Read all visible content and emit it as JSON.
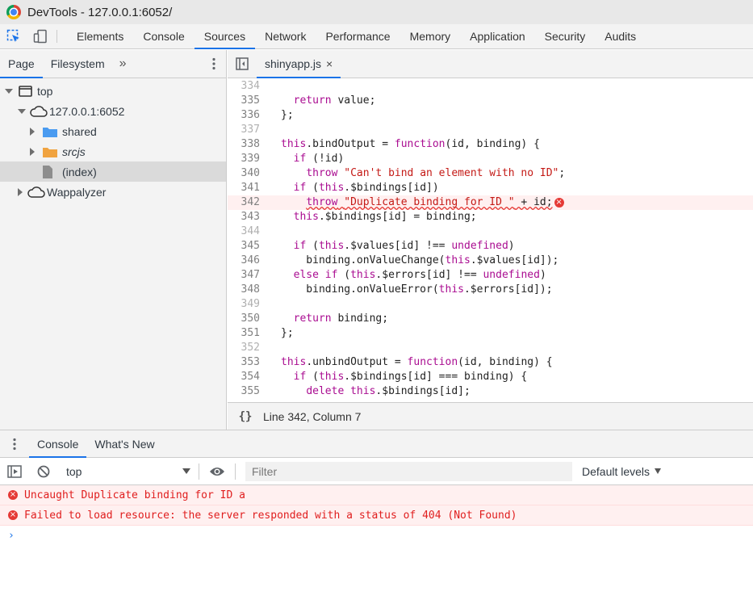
{
  "window": {
    "title": "DevTools - 127.0.0.1:6052/"
  },
  "main_tabs": [
    "Elements",
    "Console",
    "Sources",
    "Network",
    "Performance",
    "Memory",
    "Application",
    "Security",
    "Audits"
  ],
  "main_tabs_active": "Sources",
  "navigator": {
    "tabs": [
      "Page",
      "Filesystem"
    ],
    "active_tab": "Page",
    "more_symbol": "»",
    "tree": [
      {
        "label": "top",
        "expanded": true,
        "icon": "frame-icon",
        "selected": false
      },
      {
        "label": "127.0.0.1:6052",
        "expanded": true,
        "icon": "cloud-icon",
        "selected": false
      },
      {
        "label": "shared",
        "expanded": false,
        "icon": "folder-icon",
        "selected": false
      },
      {
        "label": "srcjs",
        "expanded": false,
        "icon": "folder-icon",
        "selected": false
      },
      {
        "label": "(index)",
        "expanded": null,
        "icon": "file-icon",
        "selected": true
      },
      {
        "label": "Wappalyzer",
        "expanded": false,
        "icon": "cloud-icon",
        "selected": false
      }
    ]
  },
  "editor": {
    "file_tab": "shinyapp.js",
    "close_symbol": "×",
    "lines": [
      {
        "n": "334",
        "code": "",
        "error": false
      },
      {
        "n": "335",
        "code": "    return value;",
        "error": false
      },
      {
        "n": "336",
        "code": "  };",
        "error": false
      },
      {
        "n": "337",
        "code": "",
        "error": false
      },
      {
        "n": "338",
        "code": "  this.bindOutput = function(id, binding) {",
        "error": false
      },
      {
        "n": "339",
        "code": "    if (!id)",
        "error": false
      },
      {
        "n": "340",
        "code": "      throw \"Can't bind an element with no ID\";",
        "error": false
      },
      {
        "n": "341",
        "code": "    if (this.$bindings[id])",
        "error": false
      },
      {
        "n": "342",
        "code": "      throw \"Duplicate binding for ID \" + id;",
        "error": true
      },
      {
        "n": "343",
        "code": "    this.$bindings[id] = binding;",
        "error": false
      },
      {
        "n": "344",
        "code": "",
        "error": false
      },
      {
        "n": "345",
        "code": "    if (this.$values[id] !== undefined)",
        "error": false
      },
      {
        "n": "346",
        "code": "      binding.onValueChange(this.$values[id]);",
        "error": false
      },
      {
        "n": "347",
        "code": "    else if (this.$errors[id] !== undefined)",
        "error": false
      },
      {
        "n": "348",
        "code": "      binding.onValueError(this.$errors[id]);",
        "error": false
      },
      {
        "n": "349",
        "code": "",
        "error": false
      },
      {
        "n": "350",
        "code": "    return binding;",
        "error": false
      },
      {
        "n": "351",
        "code": "  };",
        "error": false
      },
      {
        "n": "352",
        "code": "",
        "error": false
      },
      {
        "n": "353",
        "code": "  this.unbindOutput = function(id, binding) {",
        "error": false
      },
      {
        "n": "354",
        "code": "    if (this.$bindings[id] === binding) {",
        "error": false
      },
      {
        "n": "355",
        "code": "      delete this.$bindings[id];",
        "error": false
      }
    ],
    "status": {
      "braces": "{}",
      "position": "Line 342, Column 7"
    }
  },
  "drawer": {
    "tabs": [
      "Console",
      "What's New"
    ],
    "active_tab": "Console",
    "context": "top",
    "filter_placeholder": "Filter",
    "levels": "Default levels",
    "messages": [
      {
        "text": "Uncaught Duplicate binding for ID a",
        "level": "error"
      },
      {
        "text": "Failed to load resource: the server responded with a status of 404 (Not Found)",
        "level": "error"
      }
    ],
    "prompt_symbol": "›"
  },
  "colors": {
    "accent": "#1a73e8",
    "error": "#e53935",
    "error_bg": "#fff0f0",
    "keyword": "#aa0d91",
    "string": "#c41a16"
  }
}
